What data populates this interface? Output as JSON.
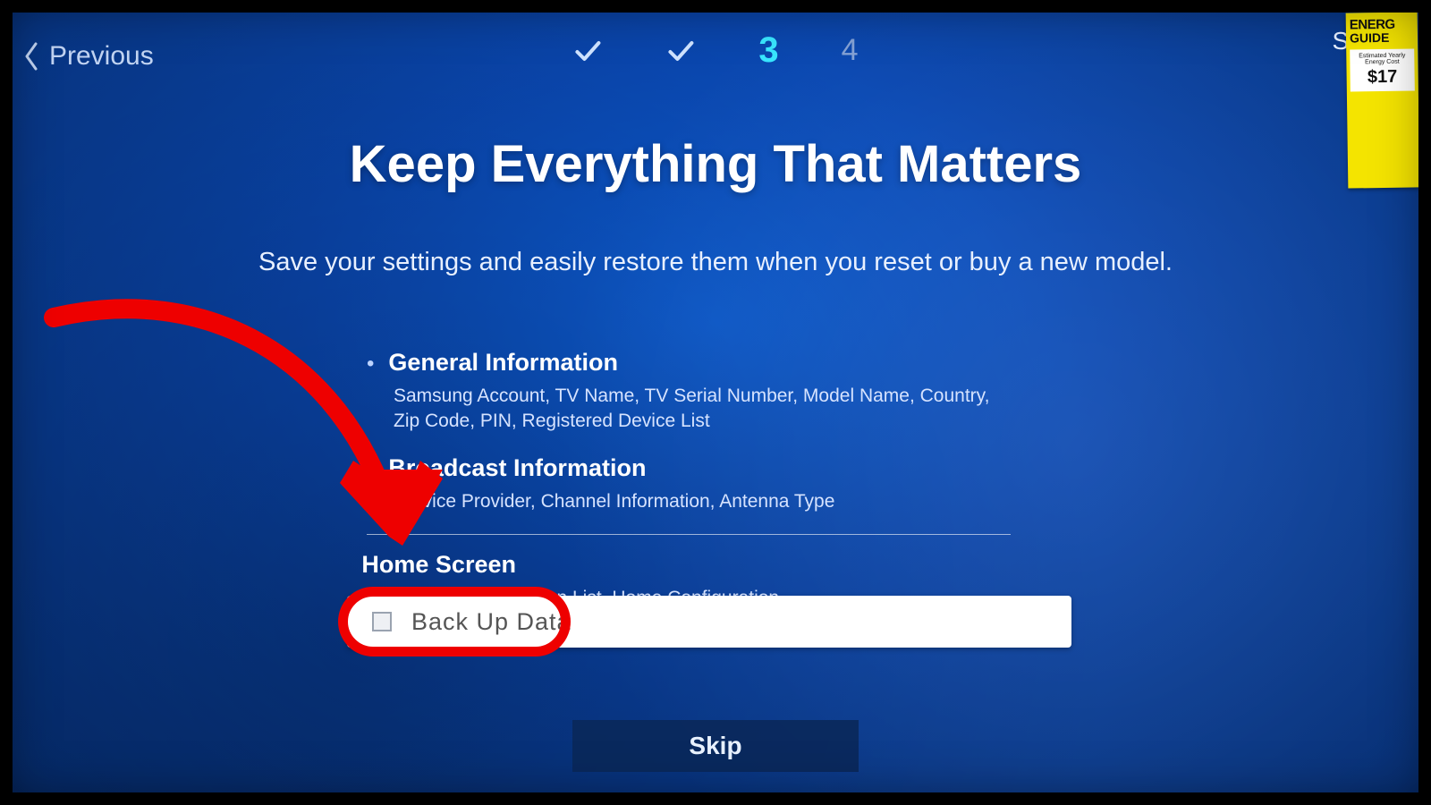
{
  "nav": {
    "previous": "Previous",
    "skip_top": "Skip"
  },
  "steps": {
    "s3": "3",
    "s4": "4"
  },
  "heading": {
    "title": "Keep Everything That Matters",
    "subtitle": "Save your settings and easily restore them when you reset or buy a new model."
  },
  "items": [
    {
      "title": "General Information",
      "desc": "Samsung Account, TV Name, TV Serial Number, Model Name, Country, Zip Code, PIN, Registered Device List"
    },
    {
      "title": "Broadcast Information",
      "desc": "Service Provider, Channel Information, Antenna Type"
    },
    {
      "title": "Home Screen",
      "desc": "Downloaded Application List, Home Configuration"
    }
  ],
  "backup_button": "Back Up Data",
  "skip_button": "Skip",
  "sticker": {
    "header": "ENERG",
    "sub": "GUIDE",
    "price": "$17"
  }
}
